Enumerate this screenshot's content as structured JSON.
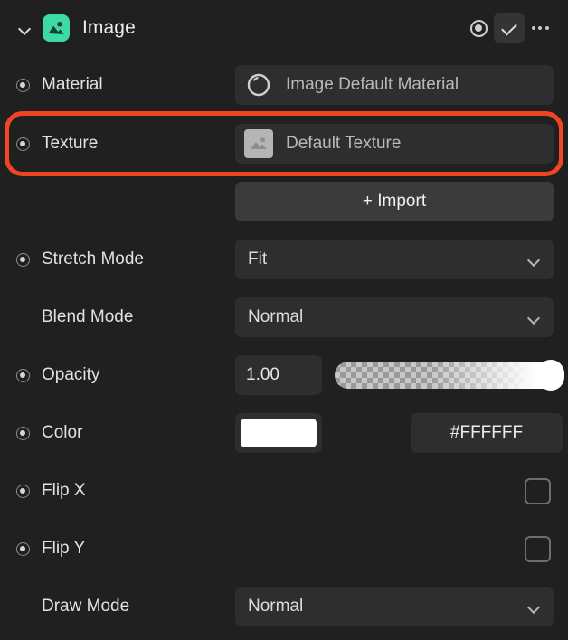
{
  "header": {
    "title": "Image",
    "node_icon": "image-icon",
    "disclosure_icon": "chevron-down-icon",
    "record_icon": "record-keyframe-icon",
    "check_icon": "check-icon",
    "more_icon": "more-options-icon"
  },
  "properties": {
    "material": {
      "label": "Material",
      "value": "Image Default Material",
      "icon": "material-sphere-icon",
      "has_keyframe_dot": true
    },
    "texture": {
      "label": "Texture",
      "value": "Default Texture",
      "icon": "texture-placeholder-icon",
      "has_keyframe_dot": true,
      "highlighted": true,
      "highlight_color": "#f04423"
    },
    "import": {
      "label": "+ Import"
    },
    "stretch_mode": {
      "label": "Stretch Mode",
      "value": "Fit",
      "has_keyframe_dot": true
    },
    "blend_mode": {
      "label": "Blend Mode",
      "value": "Normal",
      "has_keyframe_dot": false
    },
    "opacity": {
      "label": "Opacity",
      "value": "1.00",
      "slider_percent": 100,
      "has_keyframe_dot": true
    },
    "color": {
      "label": "Color",
      "swatch": "#FFFFFF",
      "hex": "#FFFFFF",
      "has_keyframe_dot": true
    },
    "flip_x": {
      "label": "Flip X",
      "checked": false,
      "has_keyframe_dot": true
    },
    "flip_y": {
      "label": "Flip Y",
      "checked": false,
      "has_keyframe_dot": true
    },
    "draw_mode": {
      "label": "Draw Mode",
      "value": "Normal",
      "has_keyframe_dot": false
    }
  }
}
